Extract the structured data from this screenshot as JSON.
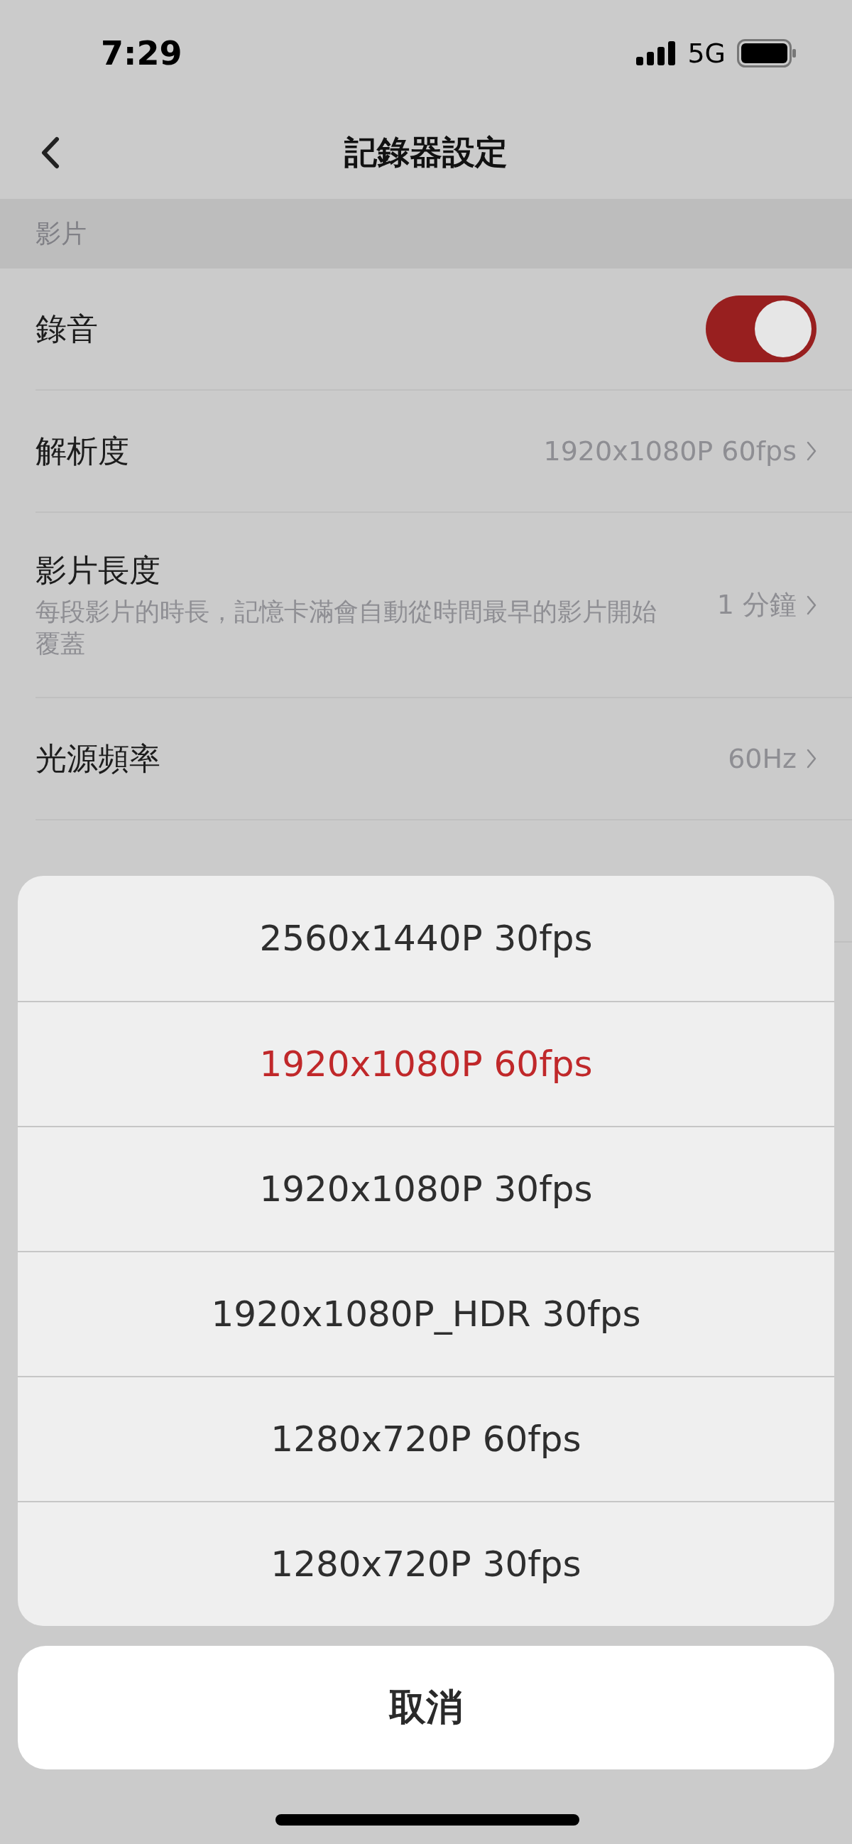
{
  "status_bar": {
    "time": "7:29",
    "network": "5G"
  },
  "nav": {
    "title": "記錄器設定"
  },
  "sections": [
    {
      "header": "影片",
      "rows": [
        {
          "kind": "toggle",
          "label": "錄音",
          "on": true
        },
        {
          "kind": "value",
          "label": "解析度",
          "value": "1920x1080P 60fps"
        },
        {
          "kind": "value",
          "label": "影片長度",
          "description": "每段影片的時長，記憶卡滿會自動從時間最早的影片開始覆蓋",
          "value": "1 分鐘"
        },
        {
          "kind": "value",
          "label": "光源頻率",
          "value": "60Hz"
        }
      ]
    }
  ],
  "action_sheet": {
    "options": [
      {
        "label": "2560x1440P 30fps",
        "selected": false
      },
      {
        "label": "1920x1080P 60fps",
        "selected": true
      },
      {
        "label": "1920x1080P 30fps",
        "selected": false
      },
      {
        "label": "1920x1080P_HDR 30fps",
        "selected": false
      },
      {
        "label": "1280x720P 60fps",
        "selected": false
      },
      {
        "label": "1280x720P 30fps",
        "selected": false
      }
    ],
    "cancel": "取消"
  }
}
